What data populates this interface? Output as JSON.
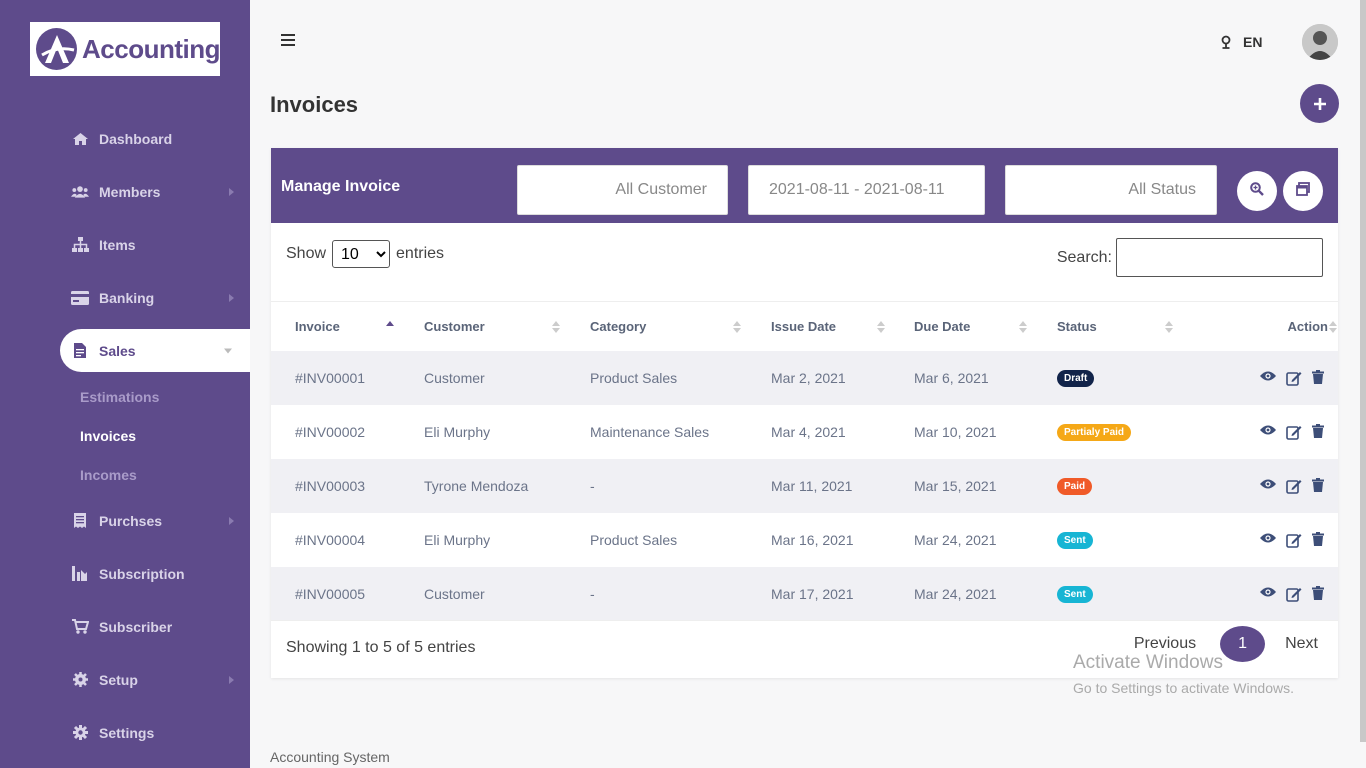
{
  "brand": {
    "name": "Accounting"
  },
  "sidebar": {
    "items": [
      {
        "label": "Dashboard",
        "icon": "home-icon",
        "has_caret": false
      },
      {
        "label": "Members",
        "icon": "users-icon",
        "has_caret": true
      },
      {
        "label": "Items",
        "icon": "sitemap-icon",
        "has_caret": false
      },
      {
        "label": "Banking",
        "icon": "card-icon",
        "has_caret": true
      },
      {
        "label": "Sales",
        "icon": "document-icon",
        "has_caret": true,
        "active": true
      },
      {
        "label": "Purchses",
        "icon": "receipt-icon",
        "has_caret": true
      },
      {
        "label": "Subscription",
        "icon": "chart-icon",
        "has_caret": false
      },
      {
        "label": "Subscriber",
        "icon": "cart-icon",
        "has_caret": false
      },
      {
        "label": "Setup",
        "icon": "cog-icon",
        "has_caret": true
      },
      {
        "label": "Settings",
        "icon": "gear-icon",
        "has_caret": false
      }
    ],
    "sales_sub": [
      {
        "label": "Estimations"
      },
      {
        "label": "Invoices",
        "current": true
      },
      {
        "label": "Incomes"
      }
    ]
  },
  "topbar": {
    "lang": "EN"
  },
  "page": {
    "title": "Invoices"
  },
  "card": {
    "title": "Manage Invoice",
    "filters": {
      "customer": "All Customer",
      "date": "2021-08-11 - 2021-08-11",
      "status": "All Status"
    },
    "show_label": "Show",
    "entries_label": "entries",
    "entries_value": "10",
    "search_label": "Search:",
    "columns": [
      "Invoice",
      "Customer",
      "Category",
      "Issue Date",
      "Due Date",
      "Status",
      "Action"
    ],
    "rows": [
      {
        "invoice": "#INV00001",
        "customer": "Customer",
        "category": "Product Sales",
        "issue": "Mar 2, 2021",
        "due": "Mar 6, 2021",
        "status": "Draft",
        "status_color": "#12244a"
      },
      {
        "invoice": "#INV00002",
        "customer": "Eli Murphy",
        "category": "Maintenance Sales",
        "issue": "Mar 4, 2021",
        "due": "Mar 10, 2021",
        "status": "Partialy Paid",
        "status_color": "#f5a817"
      },
      {
        "invoice": "#INV00003",
        "customer": "Tyrone Mendoza",
        "category": "-",
        "issue": "Mar 11, 2021",
        "due": "Mar 15, 2021",
        "status": "Paid",
        "status_color": "#f05a28"
      },
      {
        "invoice": "#INV00004",
        "customer": "Eli Murphy",
        "category": "Product Sales",
        "issue": "Mar 16, 2021",
        "due": "Mar 24, 2021",
        "status": "Sent",
        "status_color": "#17b5d4"
      },
      {
        "invoice": "#INV00005",
        "customer": "Customer",
        "category": "-",
        "issue": "Mar 17, 2021",
        "due": "Mar 24, 2021",
        "status": "Sent",
        "status_color": "#17b5d4"
      }
    ],
    "showing": "Showing 1 to 5 of 5 entries",
    "pager": {
      "prev": "Previous",
      "page": "1",
      "next": "Next"
    }
  },
  "footer": {
    "text": "Accounting System"
  },
  "watermark": {
    "line1": "Activate Windows",
    "line2": "Go to Settings to activate Windows."
  },
  "colors": {
    "primary": "#5e4b8b"
  }
}
